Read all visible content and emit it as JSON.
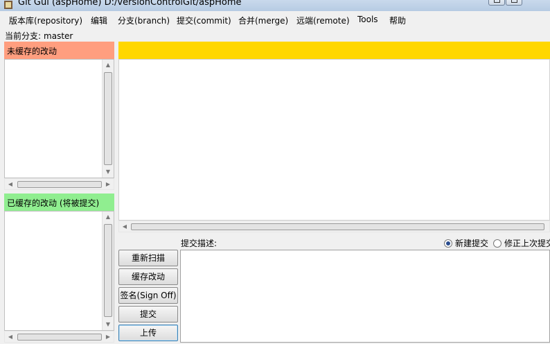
{
  "window": {
    "title": "Git Gui (aspHome) D:/versionControlGit/aspHome"
  },
  "menu": [
    "版本库(repository)",
    "编辑",
    "分支(branch)",
    "提交(commit)",
    "合并(merge)",
    "远端(remote)",
    "Tools",
    "帮助"
  ],
  "branch": {
    "label": "当前分支:",
    "name": "master"
  },
  "unstaged": {
    "header": "未缓存的改动",
    "color": "#ff9e7f"
  },
  "staged": {
    "header": "已缓存的改动 (将被提交)",
    "color": "#90ee90"
  },
  "diff": {
    "header_color": "#ffd700"
  },
  "commit": {
    "label": "提交描述:",
    "options": [
      {
        "label": "新建提交",
        "selected": true
      },
      {
        "label": "修正上次提交",
        "selected": false
      }
    ],
    "buttons": {
      "rescan": "重新扫描",
      "stage": "缓存改动",
      "signoff": "签名(Sign Off)",
      "commit": "提交",
      "push": "上传"
    }
  },
  "icons": [
    "git-app-icon",
    "minimize-icon",
    "maximize-icon",
    "radio-icon"
  ]
}
